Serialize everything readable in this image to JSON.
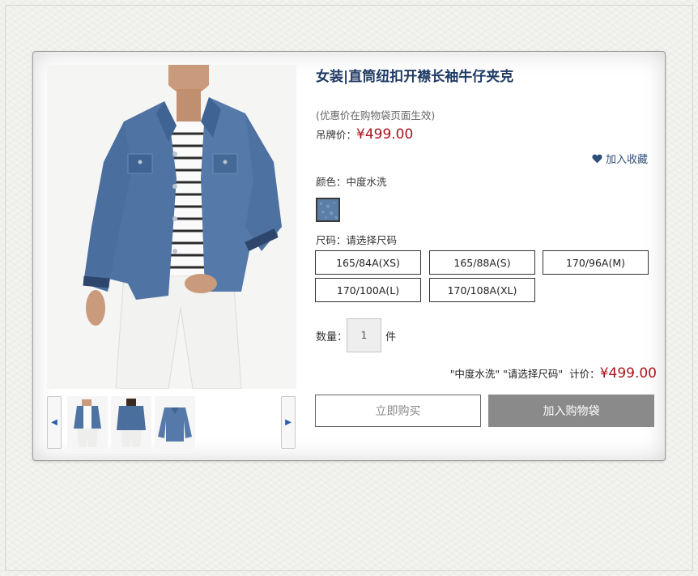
{
  "product": {
    "title": "女装|直筒纽扣开襟长袖牛仔夹克",
    "promo_note": "(优惠价在购物袋页面生效)",
    "tag_price_label": "吊牌价：",
    "tag_price": "¥499.00",
    "favorite_label": "加入收藏"
  },
  "color": {
    "label": "颜色：中度水洗",
    "swatch_color": "#5b7ea8"
  },
  "size": {
    "label": "尺码：请选择尺码",
    "options": [
      "165/84A(XS)",
      "165/88A(S)",
      "170/96A(M)",
      "170/100A(L)",
      "170/108A(XL)"
    ]
  },
  "quantity": {
    "label": "数量：",
    "value": "1",
    "unit": "件"
  },
  "summary": {
    "selection": "\"中度水洗\" \"请选择尺码\"",
    "label": "计价：",
    "total": "¥499.00"
  },
  "actions": {
    "buy_now": "立即购买",
    "add_to_cart": "加入购物袋"
  },
  "colors": {
    "title": "#1f3a63",
    "price": "#a8141c",
    "cart_button": "#8a8a8a",
    "denim": "#4f74a3"
  },
  "icons": {
    "thumb_left": "chevron-left-icon",
    "thumb_right": "chevron-right-icon",
    "favorite": "heart-icon"
  }
}
